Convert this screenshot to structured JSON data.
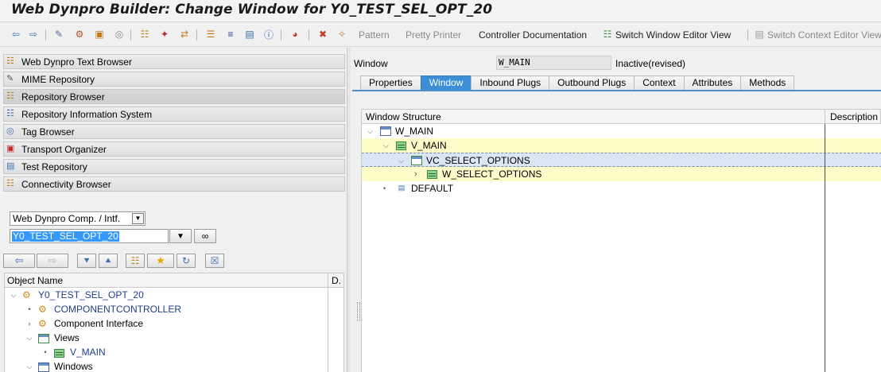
{
  "title": "Web Dynpro Builder: Change Window for Y0_TEST_SEL_OPT_20",
  "toolbar": {
    "items": [
      "Pattern",
      "Pretty Printer",
      "Controller Documentation",
      "Switch Window Editor View",
      "Switch Context Editor View"
    ]
  },
  "nav": [
    {
      "label": "Web Dynpro Text Browser",
      "icon": "text-browser-icon"
    },
    {
      "label": "MIME Repository",
      "icon": "mime-icon"
    },
    {
      "label": "Repository Browser",
      "icon": "repository-icon"
    },
    {
      "label": "Repository Information System",
      "icon": "info-system-icon"
    },
    {
      "label": "Tag Browser",
      "icon": "tag-icon"
    },
    {
      "label": "Transport Organizer",
      "icon": "truck-icon"
    },
    {
      "label": "Test Repository",
      "icon": "test-icon"
    },
    {
      "label": "Connectivity Browser",
      "icon": "connectivity-icon"
    }
  ],
  "object_type": "Web Dynpro Comp. / Intf.",
  "object_name": "Y0_TEST_SEL_OPT_20",
  "tree": {
    "col_name": "Object Name",
    "col_desc": "D.",
    "rows": [
      "Y0_TEST_SEL_OPT_20",
      "COMPONENTCONTROLLER",
      "Component Interface",
      "Views",
      "V_MAIN",
      "Windows"
    ]
  },
  "window": {
    "label": "Window",
    "name": "W_MAIN",
    "status": "Inactive(revised)"
  },
  "tabs": [
    "Properties",
    "Window",
    "Inbound Plugs",
    "Outbound Plugs",
    "Context",
    "Attributes",
    "Methods"
  ],
  "structure": {
    "col_struct": "Window Structure",
    "col_desc": "Description",
    "rows": [
      "W_MAIN",
      "V_MAIN",
      "VC_SELECT_OPTIONS",
      "W_SELECT_OPTIONS",
      "DEFAULT"
    ]
  }
}
